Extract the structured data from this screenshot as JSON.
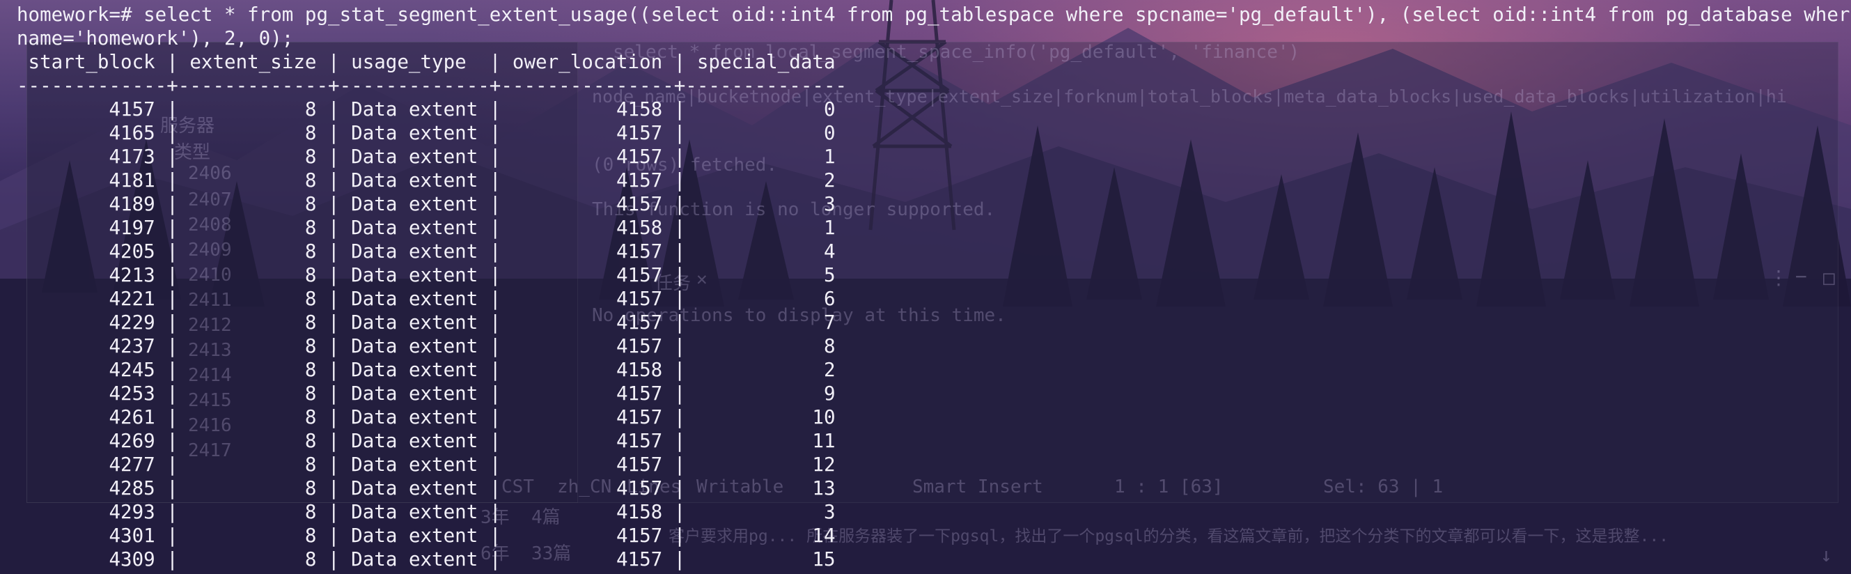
{
  "command_line_1": "homework=# select * from pg_stat_segment_extent_usage((select oid::int4 from pg_tablespace where spcname='pg_default'), (select oid::int4 from pg_database where dat",
  "command_line_2": "name='homework'), 2, 0);",
  "header_line": " start_block | extent_size | usage_type  | ower_location | special_data ",
  "divider_line": "-------------+-------------+-------------+---------------+--------------",
  "rows": [
    {
      "start_block": "4157",
      "extent_size": "8",
      "usage_type": "Data extent",
      "ower_location": "4158",
      "special_data": "0"
    },
    {
      "start_block": "4165",
      "extent_size": "8",
      "usage_type": "Data extent",
      "ower_location": "4157",
      "special_data": "0"
    },
    {
      "start_block": "4173",
      "extent_size": "8",
      "usage_type": "Data extent",
      "ower_location": "4157",
      "special_data": "1"
    },
    {
      "start_block": "4181",
      "extent_size": "8",
      "usage_type": "Data extent",
      "ower_location": "4157",
      "special_data": "2"
    },
    {
      "start_block": "4189",
      "extent_size": "8",
      "usage_type": "Data extent",
      "ower_location": "4157",
      "special_data": "3"
    },
    {
      "start_block": "4197",
      "extent_size": "8",
      "usage_type": "Data extent",
      "ower_location": "4158",
      "special_data": "1"
    },
    {
      "start_block": "4205",
      "extent_size": "8",
      "usage_type": "Data extent",
      "ower_location": "4157",
      "special_data": "4"
    },
    {
      "start_block": "4213",
      "extent_size": "8",
      "usage_type": "Data extent",
      "ower_location": "4157",
      "special_data": "5"
    },
    {
      "start_block": "4221",
      "extent_size": "8",
      "usage_type": "Data extent",
      "ower_location": "4157",
      "special_data": "6"
    },
    {
      "start_block": "4229",
      "extent_size": "8",
      "usage_type": "Data extent",
      "ower_location": "4157",
      "special_data": "7"
    },
    {
      "start_block": "4237",
      "extent_size": "8",
      "usage_type": "Data extent",
      "ower_location": "4157",
      "special_data": "8"
    },
    {
      "start_block": "4245",
      "extent_size": "8",
      "usage_type": "Data extent",
      "ower_location": "4158",
      "special_data": "2"
    },
    {
      "start_block": "4253",
      "extent_size": "8",
      "usage_type": "Data extent",
      "ower_location": "4157",
      "special_data": "9"
    },
    {
      "start_block": "4261",
      "extent_size": "8",
      "usage_type": "Data extent",
      "ower_location": "4157",
      "special_data": "10"
    },
    {
      "start_block": "4269",
      "extent_size": "8",
      "usage_type": "Data extent",
      "ower_location": "4157",
      "special_data": "11"
    },
    {
      "start_block": "4277",
      "extent_size": "8",
      "usage_type": "Data extent",
      "ower_location": "4157",
      "special_data": "12"
    },
    {
      "start_block": "4285",
      "extent_size": "8",
      "usage_type": "Data extent",
      "ower_location": "4157",
      "special_data": "13"
    },
    {
      "start_block": "4293",
      "extent_size": "8",
      "usage_type": "Data extent",
      "ower_location": "4158",
      "special_data": "3"
    },
    {
      "start_block": "4301",
      "extent_size": "8",
      "usage_type": "Data extent",
      "ower_location": "4157",
      "special_data": "14"
    },
    {
      "start_block": "4309",
      "extent_size": "8",
      "usage_type": "Data extent",
      "ower_location": "4157",
      "special_data": "15"
    }
  ],
  "background_ghost": {
    "query_line": "select * from local_segment_space_info('pg_default', 'finance')",
    "columns_line": "node_name|bucketnode|extent_type|extent_size|forknum|total_blocks|meta_data_blocks|used_data_blocks|utilization|hi",
    "fetched_line": "(0 rows) fetched.",
    "unsupported_line": "This function is no longer supported.",
    "tab_label": "任务",
    "tab_close": "✕",
    "empty_message": "No operations to display at this time.",
    "sidebar_items": [
      "服务器",
      "类型",
      "2406",
      "2407",
      "2408",
      "2409",
      "2410",
      "2411",
      "2412",
      "2413",
      "2414",
      "2415",
      "2416",
      "2417"
    ],
    "status_bar": [
      "CST",
      "zh_CN",
      "Lines",
      "Writable",
      "Smart Insert",
      "1 : 1 [63]",
      "Sel: 63 | 1"
    ],
    "blog_line_1": "客户要求用pg... 所在服务器装了一下pgsql，找出了一个pgsql的分类，看这篇文章前，把这个分类下的文章都可以看一下，这是我整...",
    "blog_count_1": "3年  4篇",
    "blog_count_2": "6年  33篇"
  },
  "colors": {
    "terminal_text": "#f2f0f8",
    "background_top": "#6a4f86",
    "background_bottom": "#1f1a3c"
  }
}
